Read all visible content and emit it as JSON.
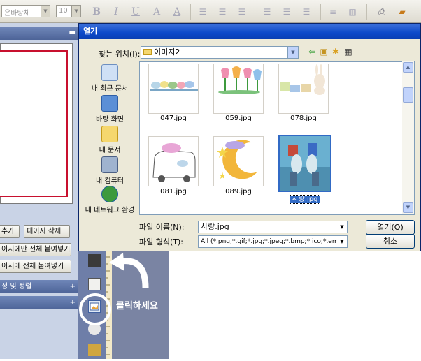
{
  "toolbar": {
    "font_combo": "은바탕체",
    "size_combo": "10",
    "buttons": [
      "bold-icon",
      "italic-icon",
      "underline-icon",
      "outline-icon",
      "shadow-icon",
      "align-left-icon",
      "align-center-icon",
      "align-right-icon",
      "justify-icon",
      "indent-icon",
      "outdent-icon",
      "line-spacing-icon",
      "columns-icon",
      "print-icon",
      "folder-icon"
    ]
  },
  "left_panel": {
    "add_button": "추가",
    "delete_page_button": "페이지 삭제",
    "paste_current_button": "이지에만 전체 붙여넣기",
    "paste_all_button": "이지에 전체 붙여넣기",
    "section1": "정 및 정렬",
    "section1_plus": "+",
    "section2_plus": "+",
    "pin": "▬"
  },
  "dialog": {
    "title": "열기",
    "lookin_label": "찾는 위치(I):",
    "lookin_value": "이미지2",
    "places": [
      {
        "label": "내 최근 문서",
        "icon": "recent-documents-icon",
        "color": "#cfe0f5"
      },
      {
        "label": "바탕 화면",
        "icon": "desktop-icon",
        "color": "#5b8fd6"
      },
      {
        "label": "내 문서",
        "icon": "my-documents-icon",
        "color": "#f5d76e"
      },
      {
        "label": "내 컴퓨터",
        "icon": "my-computer-icon",
        "color": "#9fb3cf"
      },
      {
        "label": "내 네트워크 환경",
        "icon": "network-icon",
        "color": "#3d9a3d"
      }
    ],
    "files": [
      {
        "name": "047.jpg",
        "selected": false
      },
      {
        "name": "059.jpg",
        "selected": false
      },
      {
        "name": "078.jpg",
        "selected": false
      },
      {
        "name": "081.jpg",
        "selected": false
      },
      {
        "name": "089.jpg",
        "selected": false
      },
      {
        "name": "사랑.jpg",
        "selected": true
      }
    ],
    "filename_label": "파일 이름(N):",
    "filename_value": "사랑.jpg",
    "filetype_label": "파일 형식(T):",
    "filetype_value": "All (*.png;*.gif;*.jpg;*.jpeg;*.bmp;*.ico;*.emf;*.",
    "open_button": "열기(O)",
    "cancel_button": "취소"
  },
  "callout": {
    "text": "클릭하세요"
  },
  "colors": {
    "title_bar": "#0c49c9",
    "selection": "#316ac5",
    "panel": "#c9d3e6",
    "panel_header": "#4d6498"
  }
}
